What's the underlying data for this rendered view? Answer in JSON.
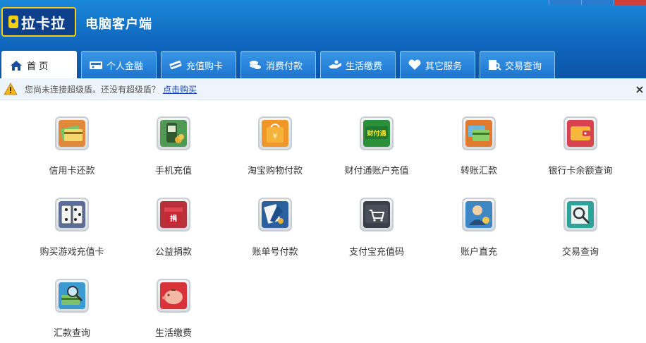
{
  "header": {
    "logo_text": "拉卡拉",
    "app_title": "电脑客户端"
  },
  "tabs": [
    {
      "label": "首 页",
      "icon": "home-icon",
      "active": true
    },
    {
      "label": "个人金融",
      "icon": "finance-icon"
    },
    {
      "label": "充值购卡",
      "icon": "card-icon"
    },
    {
      "label": "消费付款",
      "icon": "coins-icon"
    },
    {
      "label": "生活缴费",
      "icon": "hand-icon"
    },
    {
      "label": "其它服务",
      "icon": "heart-icon"
    },
    {
      "label": "交易查询",
      "icon": "receipt-search-icon"
    }
  ],
  "notice": {
    "text": "您尚未连接超级盾。还没有超级盾？",
    "link": "点击购买",
    "close": "×"
  },
  "services": [
    {
      "label": "信用卡还款",
      "icon": "credit-card-icon",
      "color": "#e0893a"
    },
    {
      "label": "手机充值",
      "icon": "mobile-topup-icon",
      "color": "#4f9a55"
    },
    {
      "label": "淘宝购物付款",
      "icon": "taobao-bag-icon",
      "color": "#f0962b"
    },
    {
      "label": "财付通账户充值",
      "icon": "tenpay-icon",
      "color": "#2c8f3a"
    },
    {
      "label": "转账汇款",
      "icon": "transfer-icon",
      "color": "#e07a2e"
    },
    {
      "label": "银行卡余额查询",
      "icon": "wallet-icon",
      "color": "#d9434e"
    },
    {
      "label": "购买游戏充值卡",
      "icon": "game-dice-icon",
      "color": "#5c6f9c"
    },
    {
      "label": "公益捐款",
      "icon": "charity-gift-icon",
      "color": "#b8303a"
    },
    {
      "label": "账单号付款",
      "icon": "bill-pay-icon",
      "color": "#2b5f9e"
    },
    {
      "label": "支付宝充值码",
      "icon": "shopping-cart-icon",
      "color": "#3a3f4a"
    },
    {
      "label": "账户直充",
      "icon": "account-user-icon",
      "color": "#3e86c4"
    },
    {
      "label": "交易查询",
      "icon": "search-doc-icon",
      "color": "#2fa39a"
    },
    {
      "label": "汇款查询",
      "icon": "remit-search-icon",
      "color": "#3b9ad0"
    },
    {
      "label": "生活缴费",
      "icon": "piggy-bank-icon",
      "color": "#d8323a"
    }
  ]
}
